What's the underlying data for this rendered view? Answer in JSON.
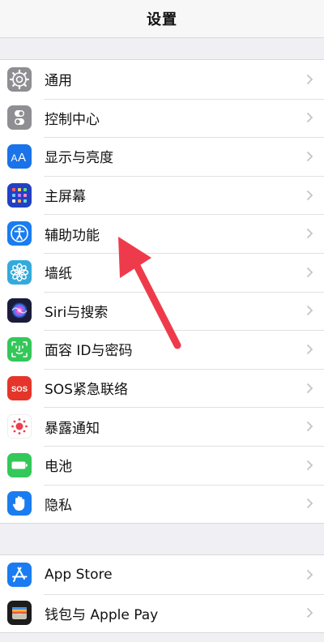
{
  "header": {
    "title": "设置"
  },
  "groups": [
    {
      "items": [
        {
          "label": "通用",
          "icon": "gear-icon",
          "color": "#8e8e93"
        },
        {
          "label": "控制中心",
          "icon": "toggles-icon",
          "color": "#8e8e93"
        },
        {
          "label": "显示与亮度",
          "icon": "text-size-icon",
          "color": "#1a73e8"
        },
        {
          "label": "主屏幕",
          "icon": "app-grid-icon",
          "color": "#2340c4"
        },
        {
          "label": "辅助功能",
          "icon": "accessibility-icon",
          "color": "#1a7cf0"
        },
        {
          "label": "墙纸",
          "icon": "flower-icon",
          "color": "#34aadc"
        },
        {
          "label": "Siri与搜索",
          "icon": "siri-icon",
          "color": "#1b1b3a"
        },
        {
          "label": "面容 ID与密码",
          "icon": "face-id-icon",
          "color": "#34c759"
        },
        {
          "label": "SOS紧急联络",
          "icon": "sos-icon",
          "color": "#e5352b"
        },
        {
          "label": "暴露通知",
          "icon": "exposure-icon",
          "color": "#ffffff"
        },
        {
          "label": "电池",
          "icon": "battery-icon",
          "color": "#34c759"
        },
        {
          "label": "隐私",
          "icon": "hand-icon",
          "color": "#1a7cf0"
        }
      ]
    },
    {
      "items": [
        {
          "label": "App Store",
          "icon": "app-store-icon",
          "color": "#1a7cf0"
        },
        {
          "label": "钱包与 Apple Pay",
          "icon": "wallet-icon",
          "color": "#1c1c1e"
        }
      ]
    }
  ],
  "icons": {
    "sos_text": "SOS"
  },
  "annotation": {
    "icon": "pointer-arrow-icon",
    "color": "#ee3b4b"
  }
}
